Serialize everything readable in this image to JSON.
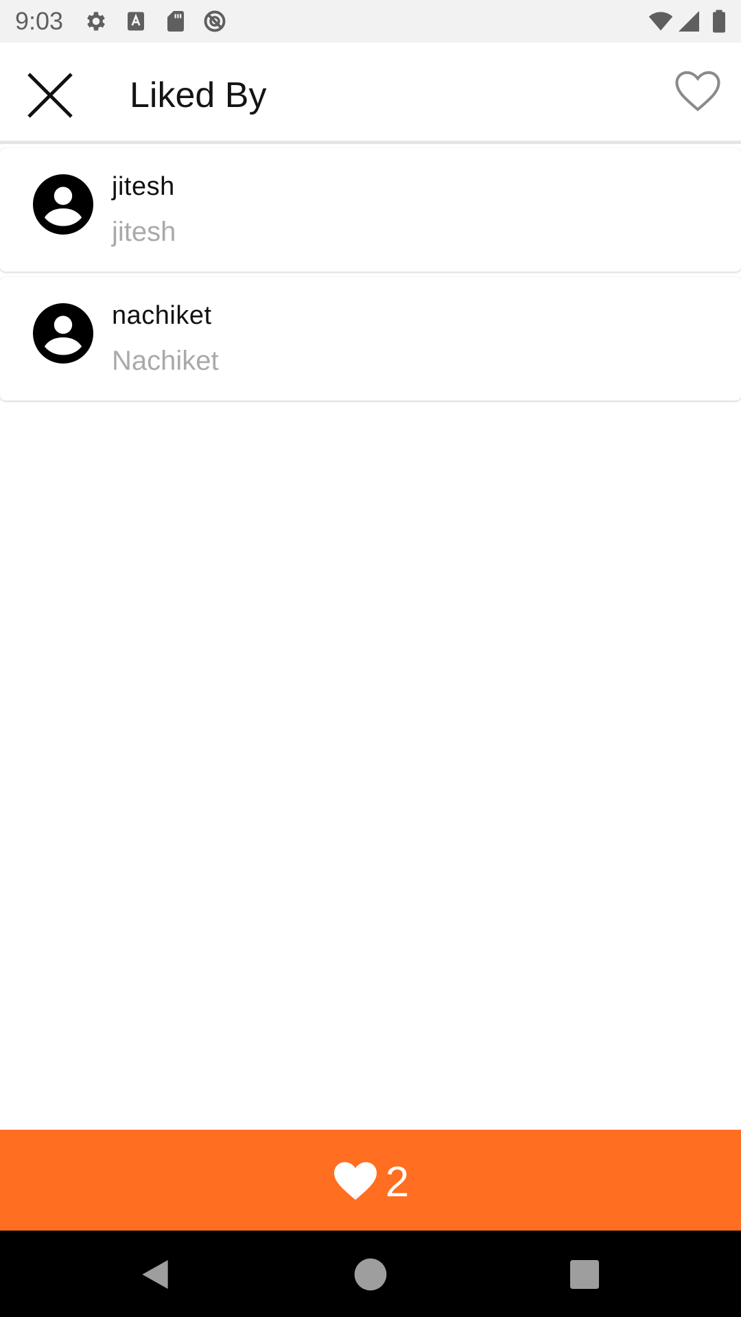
{
  "status_bar": {
    "time": "9:03",
    "icons": [
      "settings-icon",
      "text-a-icon",
      "sd-card-icon",
      "no-tracking-icon",
      "wifi-icon",
      "signal-icon",
      "battery-icon"
    ]
  },
  "app_bar": {
    "close_icon": "close-icon",
    "title": "Liked By",
    "like_icon": "heart-outline-icon"
  },
  "likers": [
    {
      "username": "jitesh",
      "full_name": "jitesh",
      "avatar_icon": "account-circle-icon"
    },
    {
      "username": "nachiket",
      "full_name": "Nachiket",
      "avatar_icon": "account-circle-icon"
    }
  ],
  "like_bar": {
    "icon": "heart-filled-icon",
    "count": "2",
    "color": "#ff6e21"
  },
  "nav_bar": {
    "icons": [
      "back-icon",
      "home-icon",
      "recents-icon"
    ]
  }
}
